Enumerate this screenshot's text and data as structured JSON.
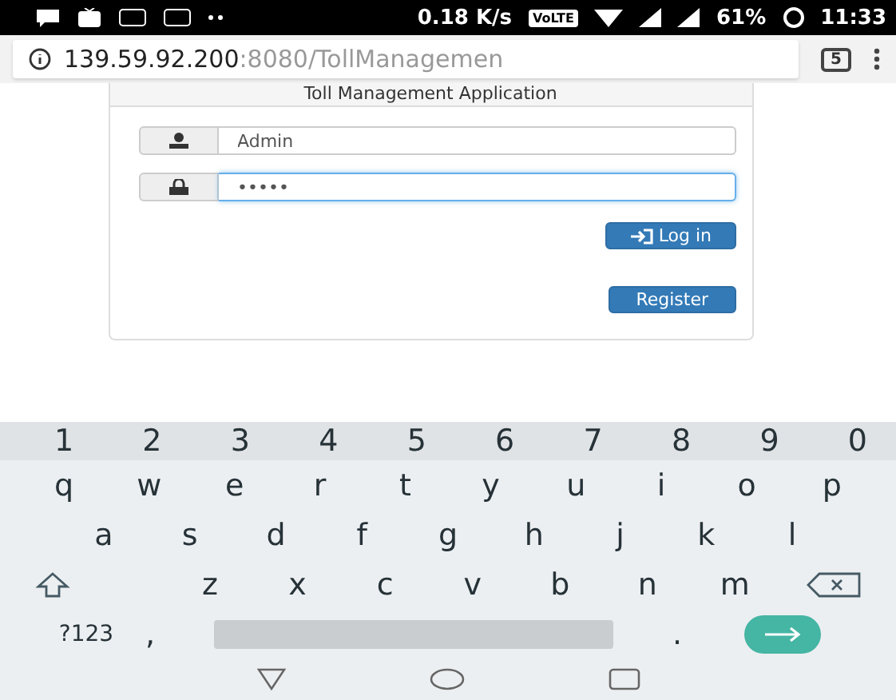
{
  "status_bar": {
    "network_speed": "0.18 K/s",
    "volte": "VoLTE",
    "battery": "61%",
    "time": "11:33"
  },
  "address_bar": {
    "host": "139.59.92.200",
    "path": ":8080/TollManagemen",
    "tab_count": "5"
  },
  "login_panel": {
    "title": "Toll Management Application",
    "fields": [
      {
        "kind": "user",
        "value": "Admin",
        "focused": false
      },
      {
        "kind": "lock",
        "value": "•••••",
        "focused": true
      }
    ],
    "buttons": [
      {
        "kind": "icon",
        "label": "Log in"
      },
      {
        "kind": "plain",
        "label": "Register"
      }
    ]
  },
  "keyboard": {
    "number_row": [
      "1",
      "2",
      "3",
      "4",
      "5",
      "6",
      "7",
      "8",
      "9",
      "0"
    ],
    "letter_rows": [
      [
        "q",
        "w",
        "e",
        "r",
        "t",
        "y",
        "u",
        "i",
        "o",
        "p"
      ],
      [
        "a",
        "s",
        "d",
        "f",
        "g",
        "h",
        "j",
        "k",
        "l"
      ],
      [
        "z",
        "x",
        "c",
        "v",
        "b",
        "n",
        "m"
      ]
    ],
    "symbols_key": "?123",
    "comma_key": ",",
    "period_key": "."
  }
}
